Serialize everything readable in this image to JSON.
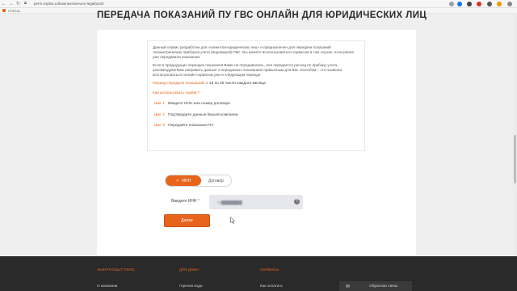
{
  "browser": {
    "url": "perm.esplus.ru/business/service-legal/post/",
    "bookmark_label": "PORTAL"
  },
  "page": {
    "title": "ПЕРЕДАЧА ПОКАЗАНИЙ ПУ ГВС ОНЛАЙН ДЛЯ ЮРИДИЧЕСКИХ ЛИЦ"
  },
  "info": {
    "para1": "Данный сервис разработан для «клиентов-юридических лиц» и предназначен для передачи показаний тахометрических приборов учета (водомеров) ГВС. Вы можете воспользоваться сервисом в том случае, если ранее уже передавали показания.",
    "para2": "Если в предыдущих периодах показания Вами не передавались, или передается расход по прибору учета, рекомендуем Вам направить данные о переданных показаниях привычным для Вас способом – это позволит воспользоваться онлайн-сервисом уже в следующем периоде.",
    "period_label": "Период передачи показаний:",
    "period_value": "с 16 по 25 число каждого месяца",
    "howto": "Как использовать сервис?",
    "steps": [
      {
        "label": "Шаг 1",
        "text": "Введите ИНН или номер договора"
      },
      {
        "label": "Шаг 2",
        "text": "Подтвердите данные Вашей компании"
      },
      {
        "label": "Шаг 3",
        "text": "Передайте показания ПУ"
      }
    ]
  },
  "form": {
    "toggle_on": "ИНН",
    "toggle_off": "Договор",
    "inn_label": "Введите ИНН",
    "inn_value": "59████████",
    "next_button": "Далее"
  },
  "footer": {
    "col1_head": "ЭНЕРГОСБЫТ ПЛЮС",
    "col1_link": "О компании",
    "col2_head": "ДЛЯ ДОМА",
    "col2_link": "Горячая вода",
    "col3_head": "СЕРВИСЫ",
    "col3_link": "Как оплатить",
    "feedback": "Обратная связь"
  },
  "colors": {
    "accent": "#e8641c",
    "footer_bg": "#2a2a2a"
  }
}
